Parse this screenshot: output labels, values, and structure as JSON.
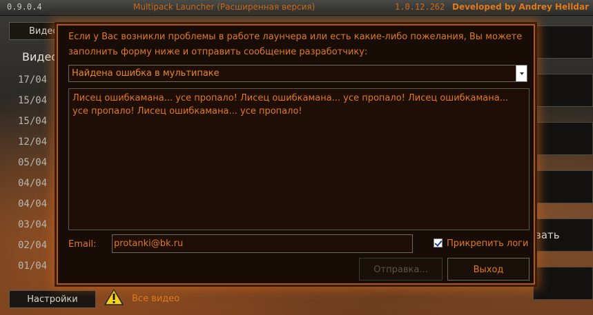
{
  "titlebar": {
    "version": "0.9.0.4",
    "title": "Multipack Launcher (Расширенная версия)",
    "build": "1.0.12.262",
    "developer": "Developed by Andrey Helldar"
  },
  "left": {
    "tab_label": "Видео",
    "heading": "Видео",
    "dates": [
      "17/04",
      "15/04",
      "15/04",
      "12/04",
      "05/04",
      "04/04",
      "04/04",
      "03/04",
      "02/04",
      "01/04"
    ]
  },
  "right": {
    "partial_label": "вать"
  },
  "bottom": {
    "settings_label": "Настройки",
    "all_videos_label": "Все видео"
  },
  "dialog": {
    "intro": "Если у Вас возникли проблемы в работе лаунчера или есть какие-либо пожелания, Вы можете заполнить форму ниже и отправить сообщение разработчику:",
    "category_selected": "Найдена ошибка в мультипаке",
    "message": "Лисец ошибкамана... усе пропало! Лисец ошибкамана... усе пропало! Лисец ошибкамана... усе пропало! Лисец ошибкамана... усе пропало!",
    "email_label": "Email:",
    "email_value": "protanki@bk.ru",
    "attach_logs_label": "Прикрепить логи",
    "attach_logs_checked": true,
    "send_label": "Отправка...",
    "exit_label": "Выход"
  },
  "colors": {
    "accent": "#e07a1a",
    "dialog_bg": "#170c06",
    "border": "#b05a18"
  }
}
